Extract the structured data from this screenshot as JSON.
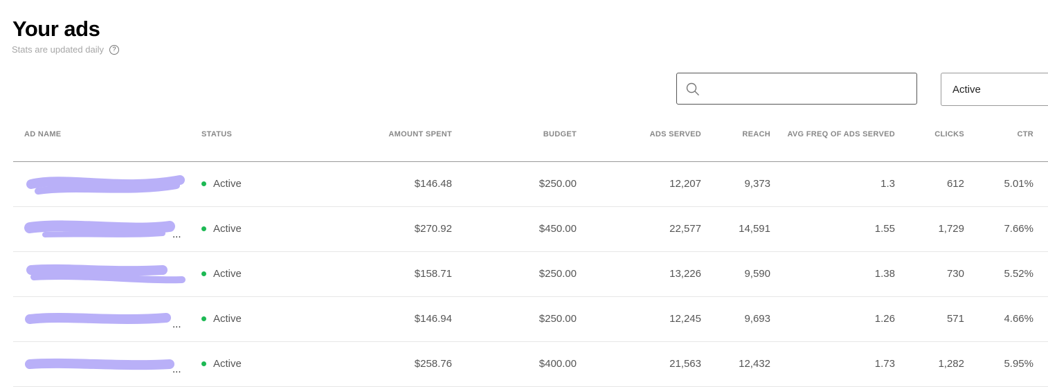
{
  "header": {
    "title": "Your ads",
    "subtitle": "Stats are updated daily",
    "help_icon": "?"
  },
  "search": {
    "value": "",
    "placeholder": ""
  },
  "filter": {
    "selected": "Active"
  },
  "colors": {
    "status_active": "#1db954",
    "redaction": "#b9b0f8"
  },
  "table": {
    "columns": [
      "AD NAME",
      "STATUS",
      "AMOUNT SPENT",
      "BUDGET",
      "ADS SERVED",
      "REACH",
      "AVG FREQ OF ADS SERVED",
      "CLICKS",
      "CTR"
    ],
    "rows": [
      {
        "name": "",
        "status": "Active",
        "amount": "$146.48",
        "budget": "$250.00",
        "served": "12,207",
        "reach": "9,373",
        "freq": "1.3",
        "clicks": "612",
        "ctr": "5.01%"
      },
      {
        "name": "...",
        "status": "Active",
        "amount": "$270.92",
        "budget": "$450.00",
        "served": "22,577",
        "reach": "14,591",
        "freq": "1.55",
        "clicks": "1,729",
        "ctr": "7.66%"
      },
      {
        "name": "",
        "status": "Active",
        "amount": "$158.71",
        "budget": "$250.00",
        "served": "13,226",
        "reach": "9,590",
        "freq": "1.38",
        "clicks": "730",
        "ctr": "5.52%"
      },
      {
        "name": "...",
        "status": "Active",
        "amount": "$146.94",
        "budget": "$250.00",
        "served": "12,245",
        "reach": "9,693",
        "freq": "1.26",
        "clicks": "571",
        "ctr": "4.66%"
      },
      {
        "name": "...",
        "status": "Active",
        "amount": "$258.76",
        "budget": "$400.00",
        "served": "21,563",
        "reach": "12,432",
        "freq": "1.73",
        "clicks": "1,282",
        "ctr": "5.95%"
      }
    ]
  }
}
